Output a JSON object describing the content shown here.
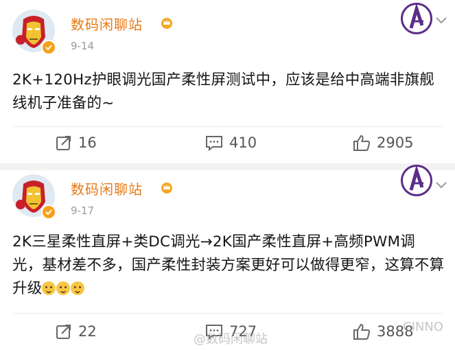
{
  "posts": [
    {
      "author": "数码闲聊站",
      "date": "9-14",
      "content": "2K+120Hz护眼调光国产柔性屏测试中，应该是给中高端非旗舰线机子准备的~",
      "actions": {
        "repost": "16",
        "comment": "410",
        "like": "2905"
      }
    },
    {
      "author": "数码闲聊站",
      "date": "9-17",
      "content": "2K三星柔性直屏+类DC调光→2K国产柔性直屏+高频PWM调光，基材差不多，国产柔性封装方案更好可以做得更窄，这算不算升级",
      "actions": {
        "repost": "22",
        "comment": "727",
        "like": "3888"
      }
    }
  ],
  "icons": {
    "avatar": "iron-man-avatar",
    "verified": "verified-badge-icon",
    "crown": "crown-icon",
    "badge": "avengers-logo-icon",
    "more": "chevron-down-icon",
    "repost": "repost-icon",
    "comment": "comment-icon",
    "like": "like-icon",
    "emoji": "doge-emoji"
  },
  "colors": {
    "author_name": "#e97812",
    "date": "#9a9a9a",
    "counts": "#555555",
    "divider": "#f2f2f2",
    "badge": "#5b2d88",
    "verified": "#f7a01a"
  },
  "watermark": {
    "left": "@数码闲聊站",
    "right": "CINNO"
  }
}
